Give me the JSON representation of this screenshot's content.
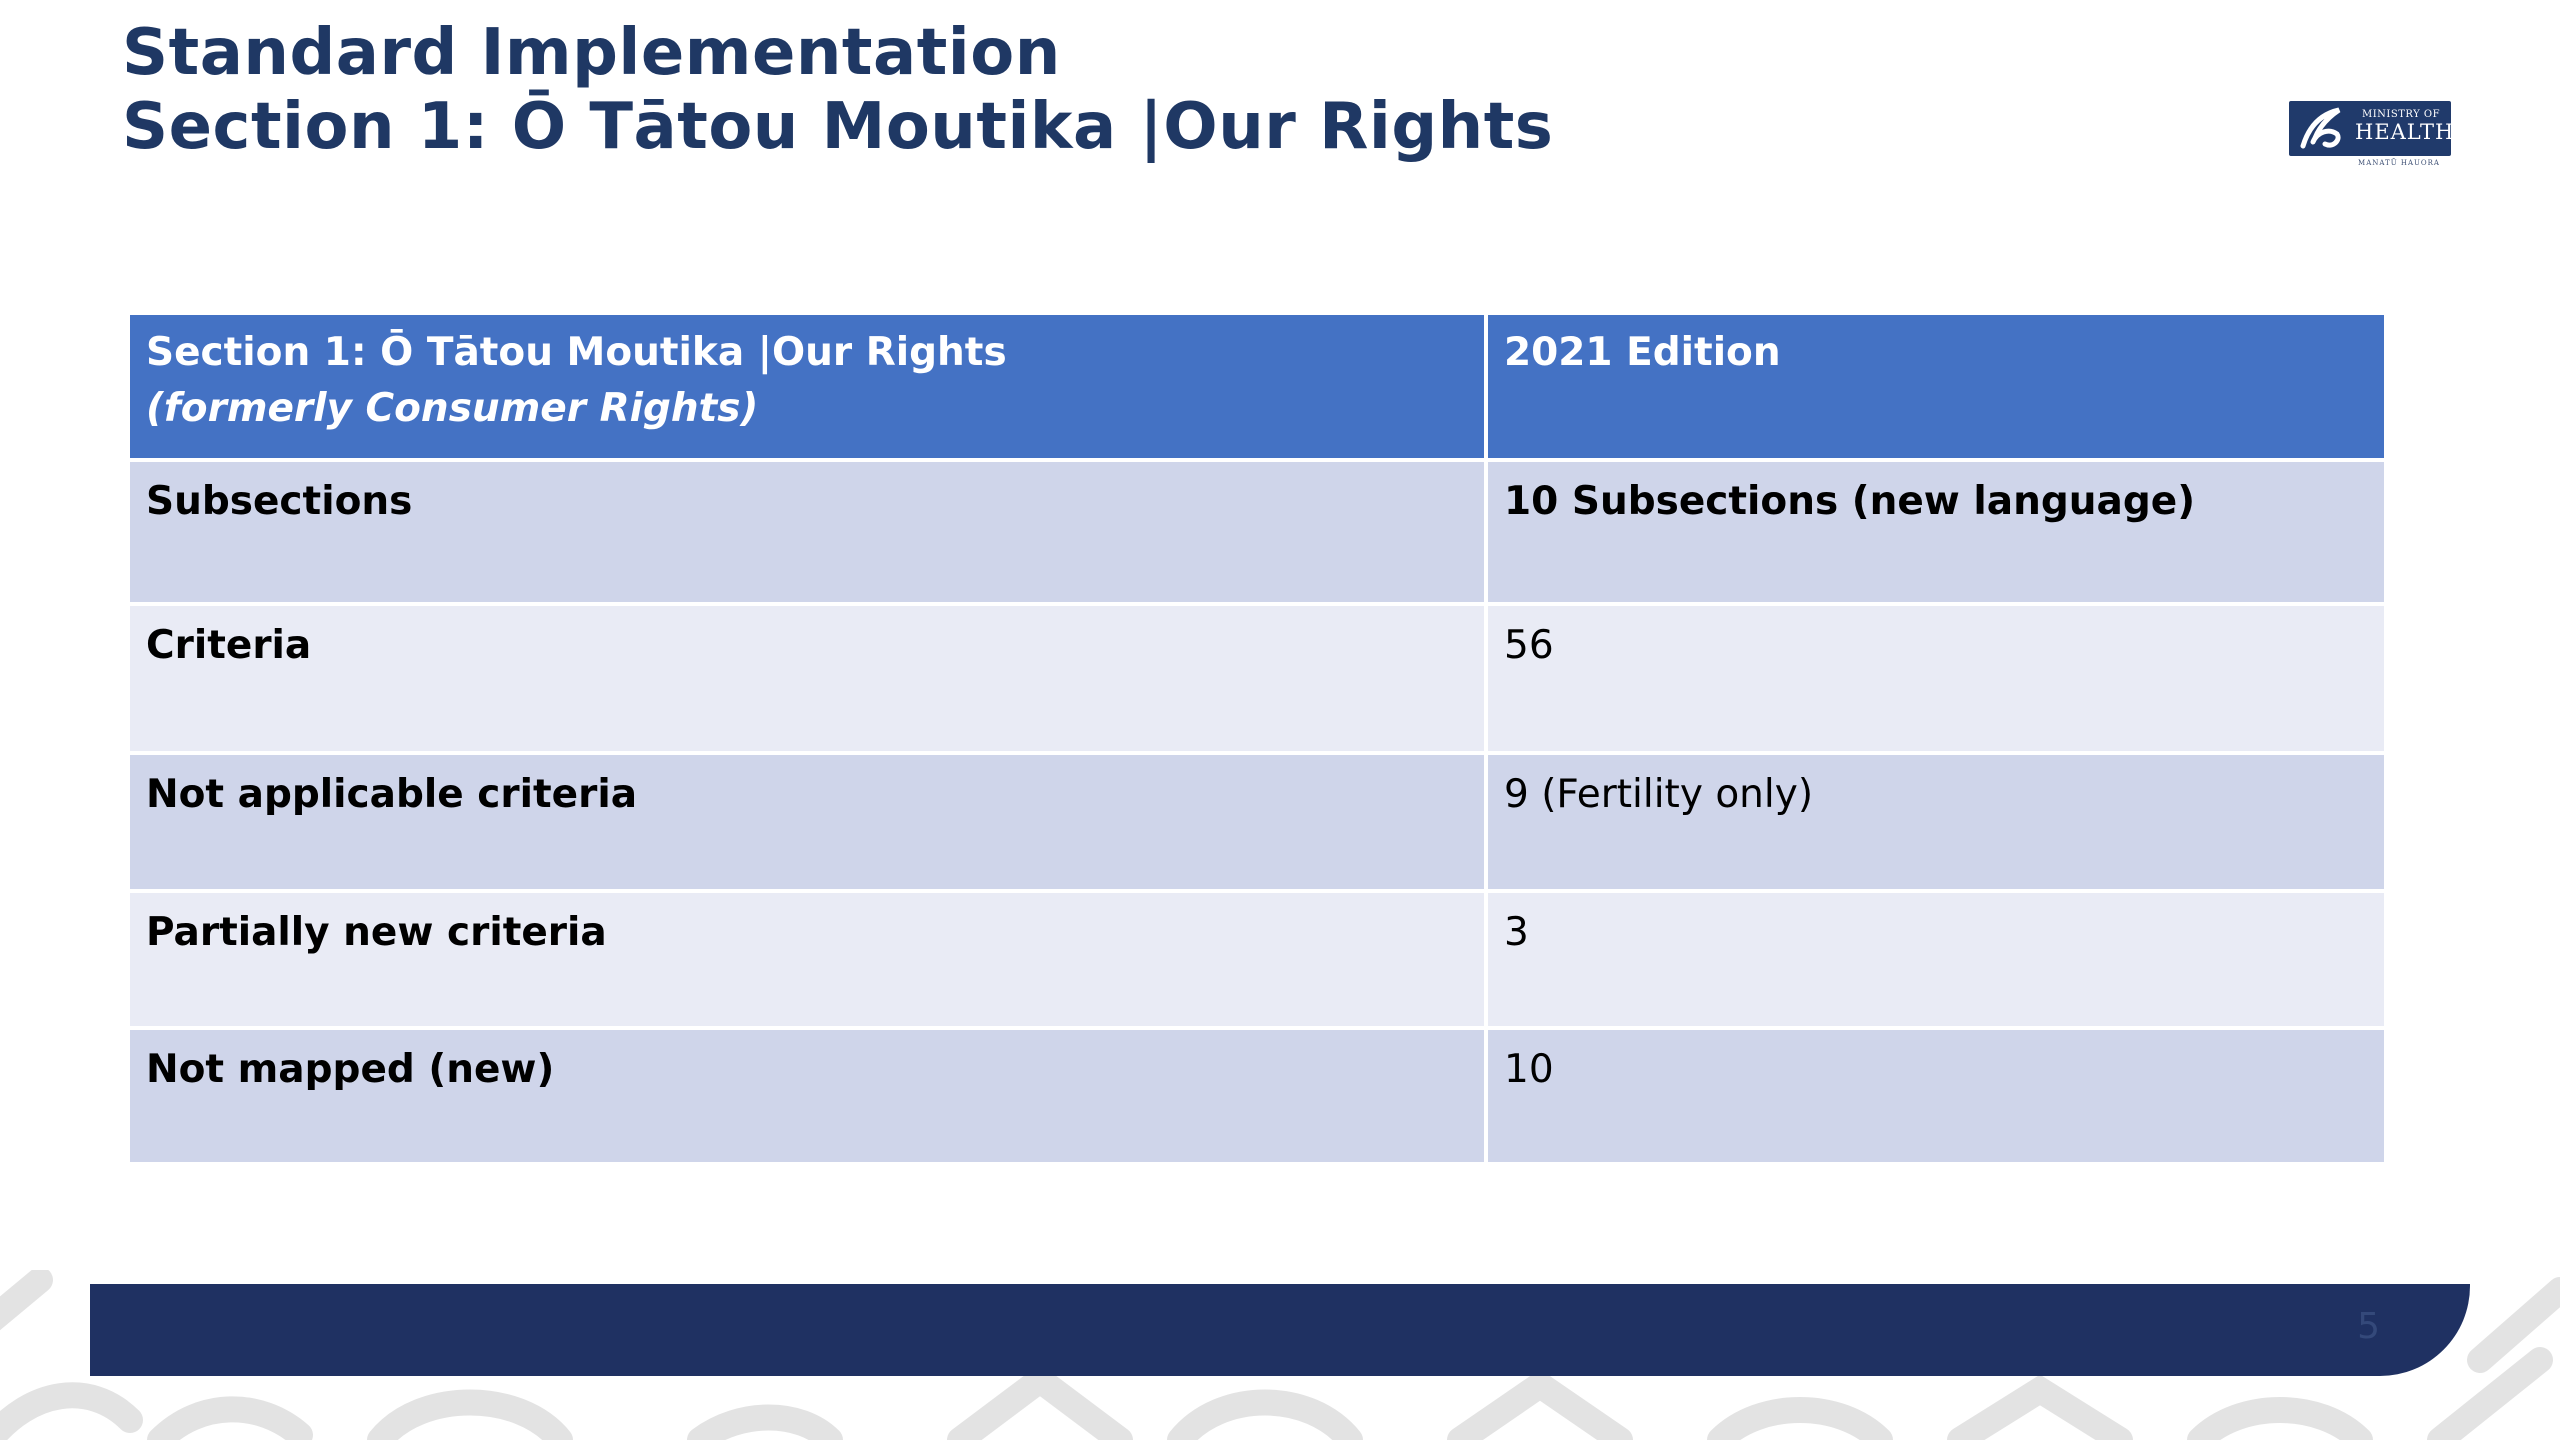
{
  "slide": {
    "title_line1": "Standard Implementation",
    "title_line2": "Section 1: Ō Tātou Moutika |Our Rights",
    "page_number": "5"
  },
  "logo": {
    "line1": "MINISTRY OF",
    "line2": "HEALTH",
    "subline": "MANATŪ HAUORA",
    "color": "#203a6b"
  },
  "table": {
    "header": {
      "col1": "Section 1: Ō Tātou Moutika |Our Rights",
      "col1_subtitle": "(formerly Consumer Rights)",
      "col2": "2021 Edition"
    },
    "rows": [
      {
        "label": "Subsections",
        "value": "10 Subsections (new language)"
      },
      {
        "label": "Criteria",
        "value": "56"
      },
      {
        "label": "Not applicable criteria",
        "value": "9 (Fertility only)"
      },
      {
        "label": "Partially new criteria",
        "value": "3"
      },
      {
        "label": "Not mapped (new)",
        "value": "10"
      }
    ]
  },
  "colors": {
    "title": "#1f3864",
    "header_bg": "#4472c4",
    "row_dark": "#cfd5ea",
    "row_light": "#e9ebf5",
    "footer_bar": "#1f3162"
  }
}
